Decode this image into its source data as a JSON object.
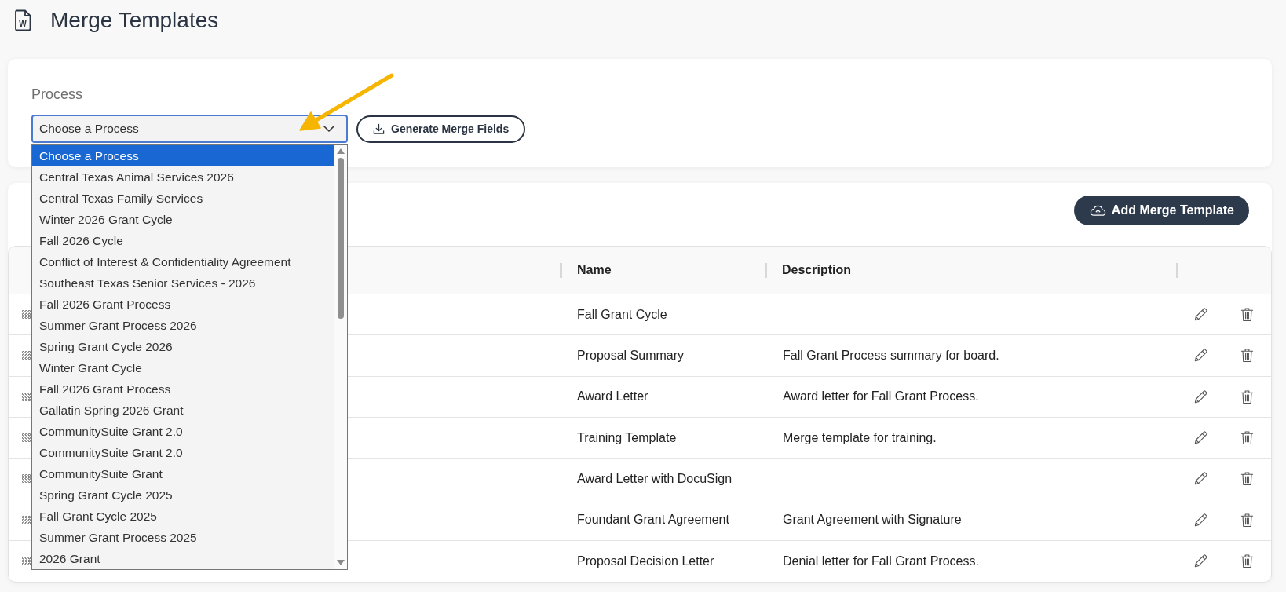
{
  "header": {
    "icon_letter": "W",
    "title": "Merge Templates"
  },
  "process": {
    "label": "Process",
    "select": {
      "value": "Choose a Process",
      "expanded": true
    },
    "options": [
      {
        "label": "Choose a Process",
        "selected": true
      },
      {
        "label": "Central Texas Animal Services 2026",
        "selected": false
      },
      {
        "label": "Central Texas Family Services",
        "selected": false
      },
      {
        "label": "Winter 2026 Grant Cycle",
        "selected": false
      },
      {
        "label": "Fall 2026 Cycle",
        "selected": false
      },
      {
        "label": "Conflict of Interest & Confidentiality Agreement",
        "selected": false
      },
      {
        "label": "Southeast Texas Senior Services - 2026",
        "selected": false
      },
      {
        "label": "Fall 2026 Grant Process",
        "selected": false
      },
      {
        "label": "Summer Grant Process 2026",
        "selected": false
      },
      {
        "label": "Spring Grant Cycle 2026",
        "selected": false
      },
      {
        "label": "Winter Grant Cycle",
        "selected": false
      },
      {
        "label": "Fall 2026 Grant Process",
        "selected": false
      },
      {
        "label": "Gallatin Spring 2026 Grant",
        "selected": false
      },
      {
        "label": "CommunitySuite Grant 2.0",
        "selected": false
      },
      {
        "label": "CommunitySuite Grant 2.0",
        "selected": false
      },
      {
        "label": "CommunitySuite Grant",
        "selected": false
      },
      {
        "label": "Spring Grant Cycle 2025",
        "selected": false
      },
      {
        "label": "Fall Grant Cycle 2025",
        "selected": false
      },
      {
        "label": "Summer Grant Process 2025",
        "selected": false
      },
      {
        "label": "2026 Grant",
        "selected": false
      }
    ],
    "generate_button": "Generate Merge Fields"
  },
  "templates": {
    "add_button": "Add Merge Template",
    "columns": [
      {
        "label": "Name"
      },
      {
        "label": "Description"
      }
    ],
    "rows": [
      {
        "name": "Fall Grant Cycle"
      },
      {
        "name": "Proposal Summary",
        "description": "Fall Grant Process summary for board."
      },
      {
        "name": "Award Letter",
        "description": "Award letter for Fall Grant Process."
      },
      {
        "name": "Training Template",
        "description": "Merge template for training."
      },
      {
        "name": "Award Letter with DocuSign"
      },
      {
        "name": "Foundant Grant Agreement",
        "description": "Grant Agreement with Signature"
      },
      {
        "name": "Proposal Decision Letter",
        "description": "Denial letter for Fall Grant Process."
      }
    ]
  }
}
